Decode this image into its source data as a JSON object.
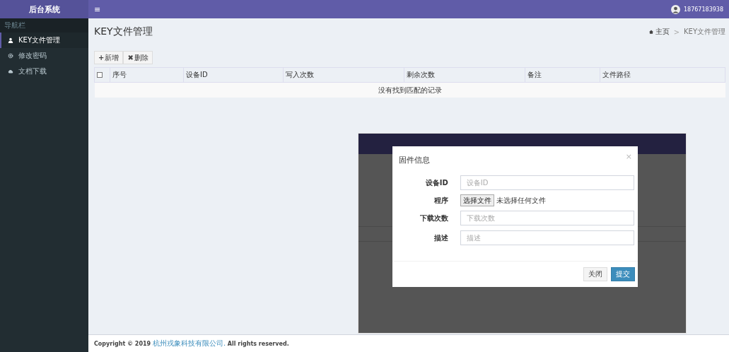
{
  "sidebar": {
    "brand": "后台系统",
    "section": "导航栏",
    "items": [
      {
        "label": "KEY文件管理",
        "selected": true
      },
      {
        "label": "修改密码",
        "selected": false
      },
      {
        "label": "文档下载",
        "selected": false
      }
    ]
  },
  "header": {
    "menu_glyph": "≡",
    "user": "18767183938"
  },
  "page": {
    "title": "KEY文件管理",
    "breadcrumb": [
      "主页",
      "KEY文件管理"
    ],
    "breadcrumb_separator": ">"
  },
  "toolbar": [
    {
      "glyph": "+",
      "label": "新增"
    },
    {
      "glyph": "✖",
      "label": "删除"
    }
  ],
  "table": {
    "select_all_checked": false,
    "columns": [
      "序号",
      "设备ID",
      "写入次数",
      "剩余次数",
      "备注",
      "文件路径"
    ],
    "empty_message": "没有找到匹配的记录"
  },
  "dialog": {
    "title": "固件信息",
    "close_glyph": "×",
    "fields": [
      {
        "kind": "text",
        "label": "设备ID",
        "placeholder": "设备ID"
      },
      {
        "kind": "file",
        "label": "程序",
        "button": "选择文件",
        "status": "未选择任何文件"
      },
      {
        "kind": "text",
        "label": "下载次数",
        "placeholder": "下载次数"
      },
      {
        "kind": "text",
        "label": "描述",
        "placeholder": "描述"
      }
    ],
    "buttons": [
      {
        "label": "关闭",
        "kind": "default"
      },
      {
        "label": "提交",
        "kind": "primary"
      }
    ]
  },
  "footer": {
    "prefix": "Copyright © 2019 ",
    "link": "杭州戎象科技有限公司.",
    "suffix": " All rights reserved."
  }
}
